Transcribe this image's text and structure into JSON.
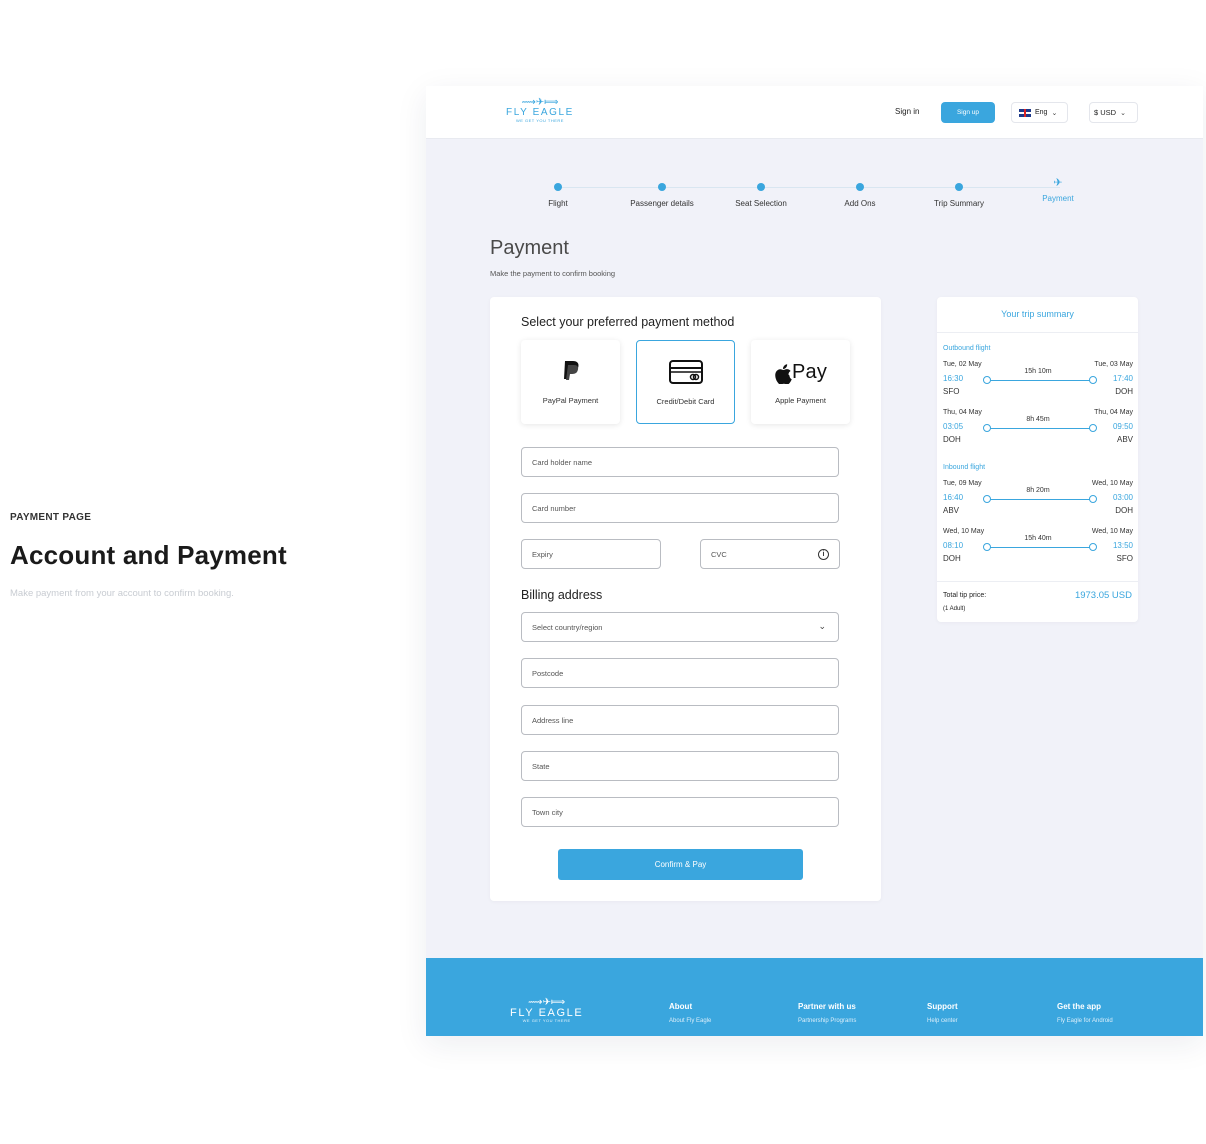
{
  "caption": {
    "kicker": "PAYMENT PAGE",
    "title": "Account and Payment",
    "description": "Make payment from your account to confirm booking."
  },
  "brand": {
    "name": "FLY EAGLE",
    "tagline": "WE GET YOU THERE",
    "accent": "#3aa6de"
  },
  "header": {
    "signin": "Sign in",
    "signup": "Sign up",
    "language": "Eng",
    "currency": "$ USD"
  },
  "stepper": {
    "steps": [
      "Flight",
      "Passenger details",
      "Seat Selection",
      "Add Ons",
      "Trip Summary",
      "Payment"
    ],
    "active_step": "Payment"
  },
  "page": {
    "title": "Payment",
    "subtitle": "Make the payment to confirm booking"
  },
  "payment": {
    "heading": "Select your preferred payment method",
    "methods": [
      {
        "label": "PayPal Payment",
        "icon": "paypal-icon"
      },
      {
        "label": "Credit/Debit Card",
        "icon": "credit-card-icon",
        "selected": true
      },
      {
        "label": "Apple Payment",
        "icon": "apple-pay-icon",
        "icon_text": "Pay"
      }
    ],
    "fields": {
      "card_holder": "Card holder name",
      "card_number": "Card number",
      "expiry": "Expiry",
      "cvc": "CVC"
    },
    "billing_heading": "Billing address",
    "billing": {
      "country": "Select country/region",
      "postcode": "Postcode",
      "address": "Address line",
      "state": "State",
      "town": "Town city"
    },
    "confirm": "Confirm & Pay"
  },
  "summary": {
    "title": "Your trip summary",
    "outbound_label": "Outbound flight",
    "inbound_label": "Inbound flight",
    "legs": [
      {
        "dep_date": "Tue, 02 May",
        "arr_date": "Tue, 03 May",
        "dep_time": "16:30",
        "arr_time": "17:40",
        "from": "SFO",
        "to": "DOH",
        "duration": "15h 10m"
      },
      {
        "dep_date": "Thu, 04 May",
        "arr_date": "Thu, 04 May",
        "dep_time": "03:05",
        "arr_time": "09:50",
        "from": "DOH",
        "to": "ABV",
        "duration": "8h 45m"
      },
      {
        "dep_date": "Tue, 09 May",
        "arr_date": "Wed, 10 May",
        "dep_time": "16:40",
        "arr_time": "03:00",
        "from": "ABV",
        "to": "DOH",
        "duration": "8h 20m"
      },
      {
        "dep_date": "Wed, 10 May",
        "arr_date": "Wed, 10 May",
        "dep_time": "08:10",
        "arr_time": "13:50",
        "from": "DOH",
        "to": "SFO",
        "duration": "15h 40m"
      }
    ],
    "total_label": "Total tip price:",
    "passengers": "(1 Adult)",
    "total_value": "1973.05 USD"
  },
  "footer": {
    "columns": [
      {
        "heading": "About",
        "link": "About Fly Eagle"
      },
      {
        "heading": "Partner with us",
        "link": "Partnership Programs"
      },
      {
        "heading": "Support",
        "link": "Help center"
      },
      {
        "heading": "Get the app",
        "link": "Fly Eagle for Android"
      }
    ]
  }
}
